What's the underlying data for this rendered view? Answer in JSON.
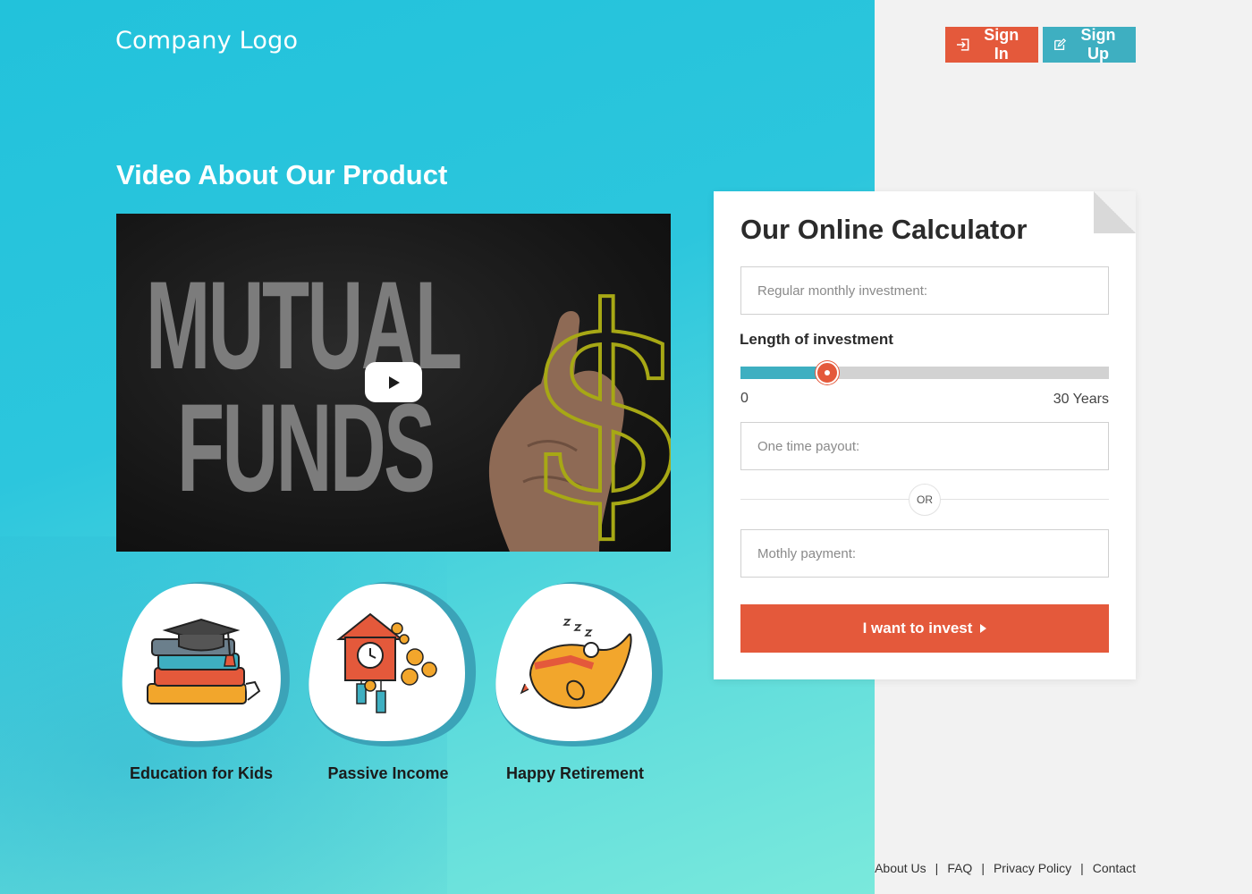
{
  "header": {
    "logo": "Company Logo",
    "sign_in": "Sign In",
    "sign_up": "Sign Up"
  },
  "video_section": {
    "title": "Video About Our Product",
    "thumbnail_line1": "MUTUAL",
    "thumbnail_line2": "FUNDS",
    "thumbnail_symbol": "$"
  },
  "features": [
    {
      "label": "Education for Kids",
      "icon": "books-graduation-cap-icon"
    },
    {
      "label": "Passive Income",
      "icon": "cuckoo-clock-coins-icon"
    },
    {
      "label": "Happy Retirement",
      "icon": "relaxing-person-icon"
    }
  ],
  "calculator": {
    "title": "Our Online Calculator",
    "monthly_placeholder": "Regular monthly investment:",
    "length_label": "Length of investment",
    "slider": {
      "min_label": "0",
      "max_label": "30 Years",
      "value_fraction": 0.235
    },
    "one_time_placeholder": "One time payout:",
    "or_label": "OR",
    "monthly_payment_placeholder": "Mothly payment:",
    "invest_button": "I want to invest"
  },
  "footer": {
    "links": [
      "About Us",
      "FAQ",
      "Privacy Policy",
      "Contact"
    ]
  },
  "colors": {
    "accent_red": "#e4593b",
    "accent_teal": "#3eafc1",
    "hero_cyan": "#22c2db"
  }
}
